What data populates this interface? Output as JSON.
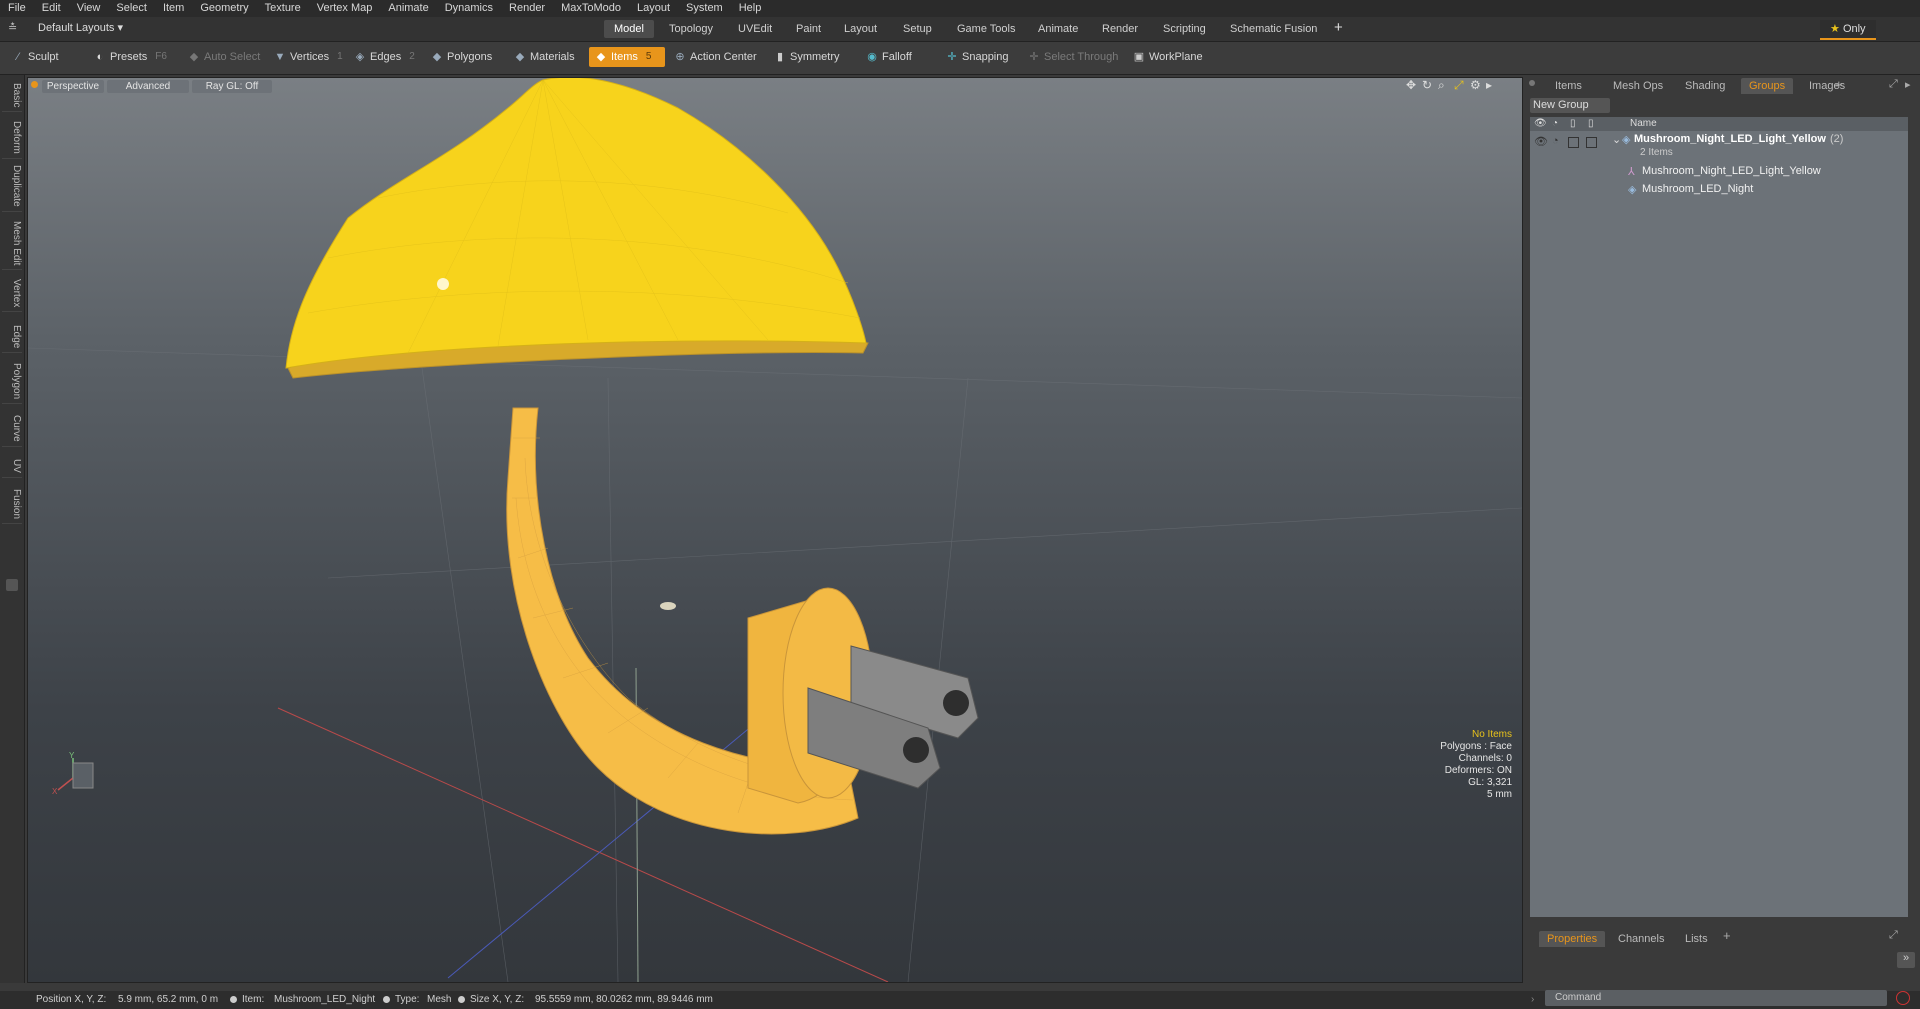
{
  "menu": [
    "File",
    "Edit",
    "View",
    "Select",
    "Item",
    "Geometry",
    "Texture",
    "Vertex Map",
    "Animate",
    "Dynamics",
    "Render",
    "MaxToModo",
    "Layout",
    "System",
    "Help"
  ],
  "layout": {
    "preset": "Default Layouts",
    "tabs": [
      "Model",
      "Topology",
      "UVEdit",
      "Paint",
      "Layout",
      "Setup",
      "Game Tools",
      "Animate",
      "Render",
      "Scripting",
      "Schematic Fusion"
    ],
    "active_tab": "Model",
    "only_label": "Only"
  },
  "toolbar": {
    "sculpt": "Sculpt",
    "presets": "Presets",
    "presets_key": "F6",
    "auto_select": "Auto Select",
    "vertices": "Vertices",
    "vertices_key": "1",
    "edges": "Edges",
    "edges_key": "2",
    "polygons": "Polygons",
    "materials": "Materials",
    "items": "Items",
    "items_key": "5",
    "action_center": "Action Center",
    "symmetry": "Symmetry",
    "falloff": "Falloff",
    "snapping": "Snapping",
    "select_through": "Select Through",
    "workplane": "WorkPlane"
  },
  "left_tabs": [
    "Basic",
    "Deform",
    "Duplicate",
    "Mesh Edit",
    "Vertex",
    "Edge",
    "Polygon",
    "Curve",
    "UV",
    "Fusion"
  ],
  "viewport": {
    "view": "Perspective",
    "shading": "Advanced",
    "raygl": "Ray GL: Off",
    "info": {
      "items": "No Items",
      "polygons": "Polygons : Face",
      "channels": "Channels: 0",
      "deformers": "Deformers: ON",
      "gl": "GL: 3,321",
      "scale": "5 mm"
    },
    "axis_y": "Y",
    "axis_x": "X"
  },
  "right_panel": {
    "tabs": [
      "Items",
      "Mesh Ops",
      "Shading",
      "Groups",
      "Images"
    ],
    "active_tab": "Groups",
    "new_group": "New Group",
    "col_name": "Name",
    "group": {
      "name": "Mushroom_Night_LED_Light_Yellow",
      "count": "(2)",
      "items_count": "2 Items",
      "children": [
        "Mushroom_Night_LED_Light_Yellow",
        "Mushroom_LED_Night"
      ]
    },
    "bottom_tabs": [
      "Properties",
      "Channels",
      "Lists"
    ],
    "bottom_active": "Properties",
    "command_placeholder": "Command"
  },
  "status": {
    "position_label": "Position X, Y, Z:",
    "position_value": "5.9 mm, 65.2 mm, 0 m",
    "item_label": "Item:",
    "item_value": "Mushroom_LED_Night",
    "type_label": "Type:",
    "type_value": "Mesh",
    "size_label": "Size X, Y, Z:",
    "size_value": "95.5559 mm, 80.0262 mm, 89.9446 mm"
  },
  "colors": {
    "accent": "#e8951b",
    "cap": "#f7d31c",
    "stem": "#f8c04a",
    "prong": "#8a8a8a"
  }
}
